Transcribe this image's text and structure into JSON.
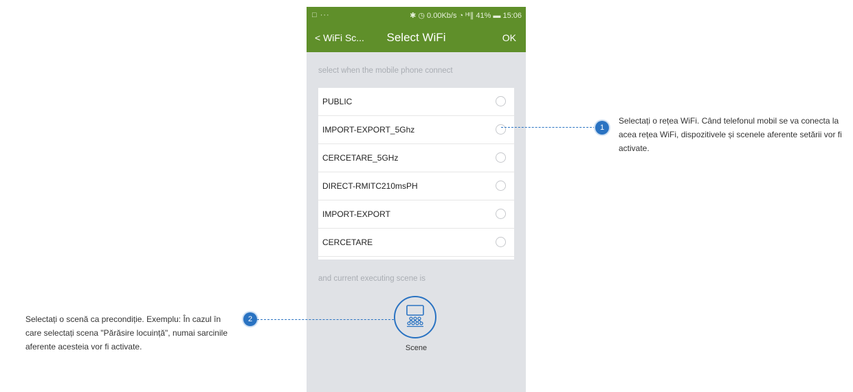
{
  "status_bar": {
    "left": "□ ···",
    "right": "✱ ◷ 0.00Kb/s ◔ ᴴᴵ∥ 41% ▬ 15:06"
  },
  "header": {
    "back_label": "< WiFi Sc...",
    "title": "Select WiFi",
    "ok_label": "OK"
  },
  "wifi_section": {
    "label": "select when the mobile phone connect",
    "networks": [
      {
        "name": "PUBLIC",
        "selected": false
      },
      {
        "name": "IMPORT-EXPORT_5Ghz",
        "selected": false
      },
      {
        "name": "CERCETARE_5GHz",
        "selected": false
      },
      {
        "name": "DIRECT-RMITC210msPH",
        "selected": false
      },
      {
        "name": "IMPORT-EXPORT",
        "selected": false
      },
      {
        "name": "CERCETARE",
        "selected": false
      }
    ]
  },
  "scene_section": {
    "label": "and current executing scene is",
    "scene_button_label": "Scene",
    "icon": "scene-theater-icon"
  },
  "annotations": [
    {
      "number": "1",
      "text": "Selectați o rețea WiFi. Când telefonul mobil se va conecta la acea rețea WiFi, dispozitivele și scenele aferente setării vor fi activate."
    },
    {
      "number": "2",
      "text": "Selectați o scenă ca precondiție. Exemplu: În cazul în care selectați scena \"Părăsire locuință\", numai sarcinile aferente acesteia vor fi activate."
    }
  ],
  "colors": {
    "header_green": "#5f8f2a",
    "accent_blue": "#2a73c2",
    "phone_background": "#e0e2e6"
  }
}
